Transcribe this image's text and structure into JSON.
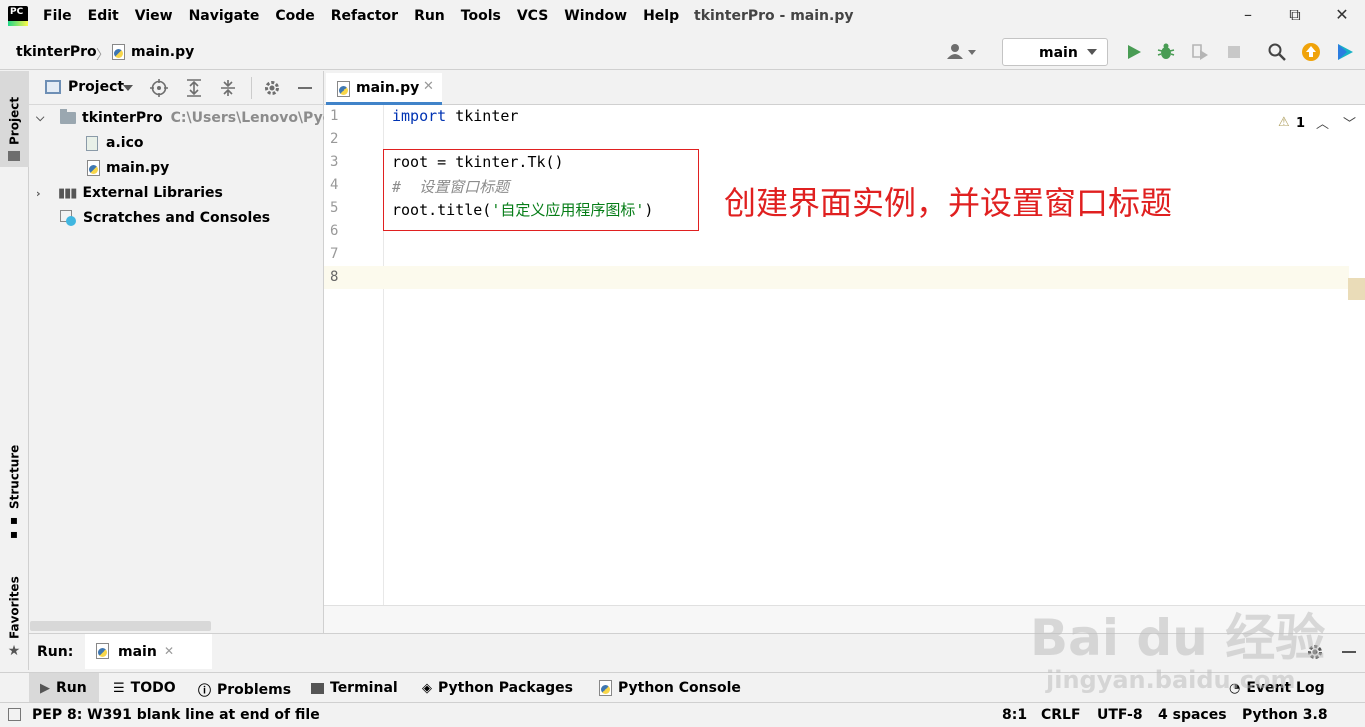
{
  "app": {
    "logo_text": "PC",
    "window_title": "tkinterPro - main.py",
    "menu": [
      "File",
      "Edit",
      "View",
      "Navigate",
      "Code",
      "Refactor",
      "Run",
      "Tools",
      "VCS",
      "Window",
      "Help"
    ],
    "window_controls": {
      "minimize": "–",
      "restore": "⧉",
      "close": "✕"
    }
  },
  "navbar": {
    "project": "tkinterPro",
    "file": "main.py",
    "run_config": "main"
  },
  "left_stripe": {
    "project": "Project",
    "structure": "Structure",
    "favorites": "Favorites"
  },
  "project_panel": {
    "title": "Project",
    "root": {
      "name": "tkinterPro",
      "path": "C:\\Users\\Lenovo\\Pyc"
    },
    "files": [
      "a.ico",
      "main.py"
    ],
    "external": "External Libraries",
    "scratches": "Scratches and Consoles"
  },
  "editor": {
    "tab": "main.py",
    "warning_count": "1",
    "line_numbers": [
      "1",
      "2",
      "3",
      "4",
      "5",
      "6",
      "7",
      "8"
    ],
    "code": {
      "l1_kw": "import",
      "l1_rest": " tkinter",
      "l3": "root = tkinter.Tk()",
      "l4": "#  设置窗口标题",
      "l5_a": "root.title(",
      "l5_str": "'自定义应用程序图标'",
      "l5_b": ")"
    },
    "annotation": "创建界面实例，并设置窗口标题"
  },
  "run_panel": {
    "label": "Run:",
    "config": "main"
  },
  "tool_tabs": [
    "Run",
    "TODO",
    "Problems",
    "Terminal",
    "Python Packages",
    "Python Console",
    "Event Log"
  ],
  "status": {
    "message": "PEP 8: W391 blank line at end of file",
    "position": "8:1",
    "line_sep": "CRLF",
    "encoding": "UTF-8",
    "indent": "4 spaces",
    "interpreter": "Python 3.8"
  },
  "watermark": {
    "brand": "Bai du 经验",
    "url": "jingyan.baidu.com"
  },
  "colors": {
    "accent": "#4083c9",
    "annotation": "#e02020",
    "run_green": "#499c54"
  }
}
